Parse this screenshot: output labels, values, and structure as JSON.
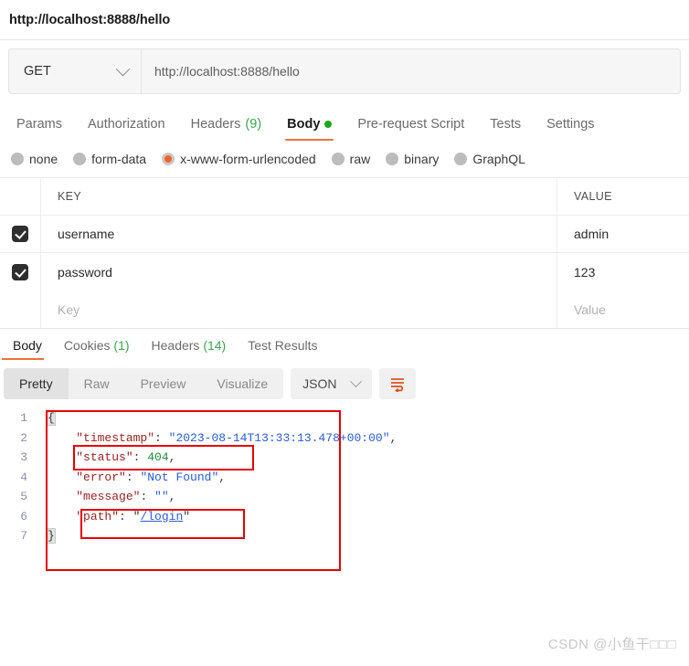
{
  "header": {
    "url_title": "http://localhost:8888/hello"
  },
  "request_bar": {
    "method": "GET",
    "method_icon": "chevron-down-icon",
    "url_value": "http://localhost:8888/hello"
  },
  "request_tabs": [
    {
      "label": "Params",
      "count": "",
      "active": false,
      "dot": false
    },
    {
      "label": "Authorization",
      "count": "",
      "active": false,
      "dot": false
    },
    {
      "label": "Headers",
      "count": "(9)",
      "active": false,
      "dot": false
    },
    {
      "label": "Body",
      "count": "",
      "active": true,
      "dot": true
    },
    {
      "label": "Pre-request Script",
      "count": "",
      "active": false,
      "dot": false
    },
    {
      "label": "Tests",
      "count": "",
      "active": false,
      "dot": false
    },
    {
      "label": "Settings",
      "count": "",
      "active": false,
      "dot": false
    }
  ],
  "body_types": [
    {
      "label": "none",
      "selected": false
    },
    {
      "label": "form-data",
      "selected": false
    },
    {
      "label": "x-www-form-urlencoded",
      "selected": true
    },
    {
      "label": "raw",
      "selected": false
    },
    {
      "label": "binary",
      "selected": false
    },
    {
      "label": "GraphQL",
      "selected": false
    }
  ],
  "kv_table": {
    "columns": {
      "key": "KEY",
      "value": "VALUE"
    },
    "rows": [
      {
        "checked": true,
        "key": "username",
        "value": "admin"
      },
      {
        "checked": true,
        "key": "password",
        "value": "123"
      }
    ],
    "new_row": {
      "key_placeholder": "Key",
      "value_placeholder": "Value"
    }
  },
  "response_tabs": [
    {
      "label": "Body",
      "count": "",
      "active": true
    },
    {
      "label": "Cookies",
      "count": "(1)",
      "active": false
    },
    {
      "label": "Headers",
      "count": "(14)",
      "active": false
    },
    {
      "label": "Test Results",
      "count": "",
      "active": false
    }
  ],
  "view_toolbar": {
    "segments": [
      {
        "label": "Pretty",
        "active": true
      },
      {
        "label": "Raw",
        "active": false
      },
      {
        "label": "Preview",
        "active": false
      },
      {
        "label": "Visualize",
        "active": false
      }
    ],
    "format_select": {
      "value": "JSON",
      "icon": "chevron-down-icon"
    },
    "wrap_button_icon": "word-wrap-icon"
  },
  "response_body": {
    "language": "json",
    "lines": [
      {
        "num": "1",
        "indent": 0,
        "tokens": [
          {
            "t": "brace",
            "v": "{"
          }
        ]
      },
      {
        "num": "2",
        "indent": 1,
        "tokens": [
          {
            "t": "key",
            "v": "\"timestamp\""
          },
          {
            "t": "pun",
            "v": ": "
          },
          {
            "t": "str",
            "v": "\"2023-08-14T13:33:13.478+00:00\""
          },
          {
            "t": "pun",
            "v": ","
          }
        ]
      },
      {
        "num": "3",
        "indent": 1,
        "tokens": [
          {
            "t": "key",
            "v": "\"status\""
          },
          {
            "t": "pun",
            "v": ": "
          },
          {
            "t": "num",
            "v": "404"
          },
          {
            "t": "pun",
            "v": ","
          }
        ]
      },
      {
        "num": "4",
        "indent": 1,
        "tokens": [
          {
            "t": "key",
            "v": "\"error\""
          },
          {
            "t": "pun",
            "v": ": "
          },
          {
            "t": "str",
            "v": "\"Not Found\""
          },
          {
            "t": "pun",
            "v": ","
          }
        ]
      },
      {
        "num": "5",
        "indent": 1,
        "tokens": [
          {
            "t": "key",
            "v": "\"message\""
          },
          {
            "t": "pun",
            "v": ": "
          },
          {
            "t": "str",
            "v": "\"\""
          },
          {
            "t": "pun",
            "v": ","
          }
        ]
      },
      {
        "num": "6",
        "indent": 1,
        "tokens": [
          {
            "t": "key",
            "v": "\"path\""
          },
          {
            "t": "pun",
            "v": ": "
          },
          {
            "t": "pun",
            "v": "\""
          },
          {
            "t": "link",
            "v": "/login"
          },
          {
            "t": "pun",
            "v": "\""
          }
        ]
      },
      {
        "num": "7",
        "indent": 0,
        "tokens": [
          {
            "t": "brace",
            "v": "}"
          }
        ]
      }
    ],
    "parsed": {
      "timestamp": "2023-08-14T13:33:13.478+00:00",
      "status": 404,
      "error": "Not Found",
      "message": "",
      "path": "/login"
    }
  },
  "annotations": {
    "color": "#e60000",
    "boxes": [
      {
        "name": "outer-json-box"
      },
      {
        "name": "status-line-box"
      },
      {
        "name": "path-line-box"
      }
    ]
  },
  "watermark": {
    "text": "CSDN @小鱼干□□□"
  },
  "colors": {
    "accent": "#f1703b",
    "success": "#19a71f",
    "annotation": "#e60000",
    "json_key": "#9b2220",
    "json_string": "#2a5bd7",
    "json_number": "#1f8a3a"
  }
}
